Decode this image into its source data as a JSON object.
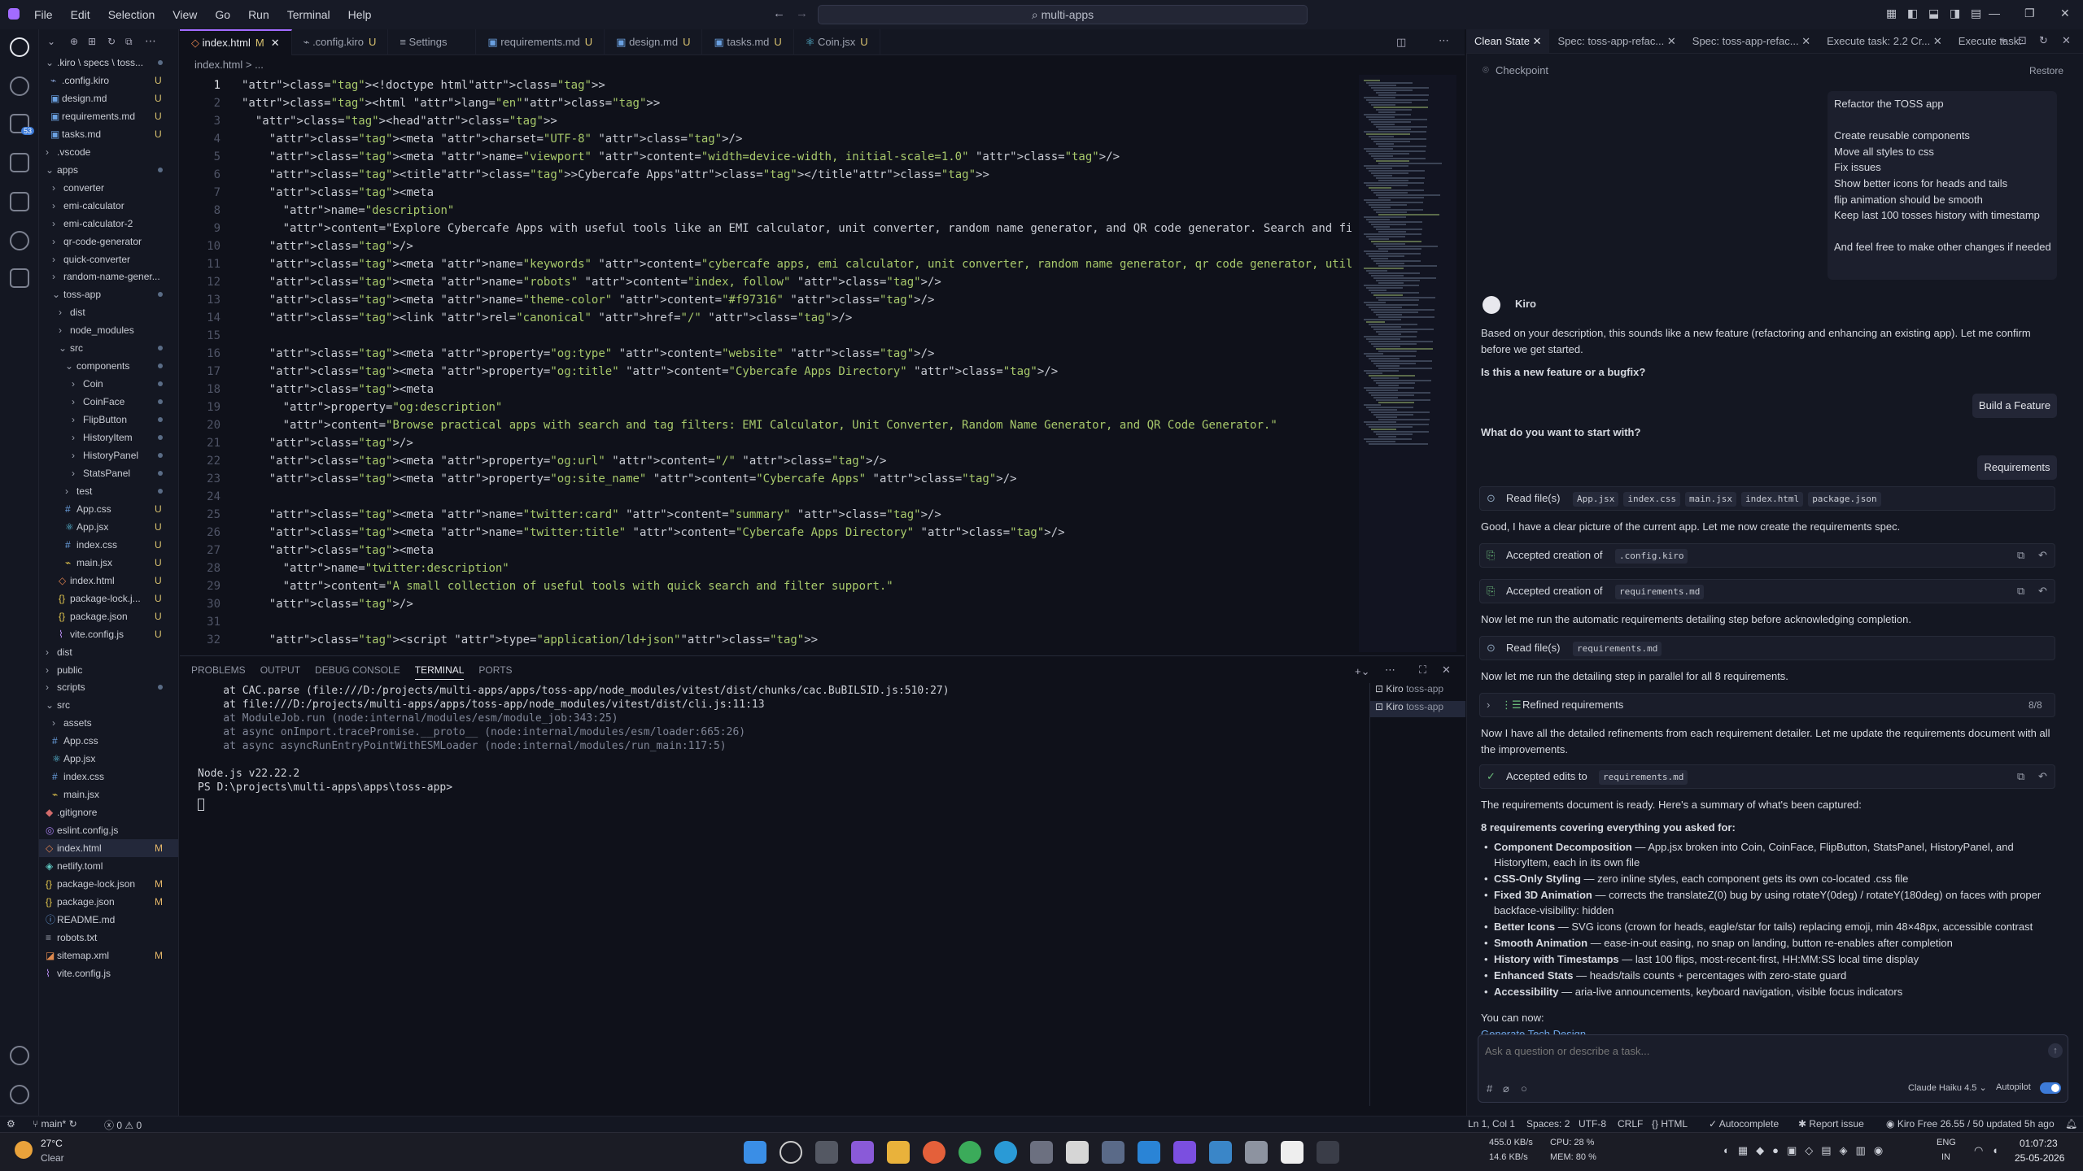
{
  "menubar": {
    "items": [
      "File",
      "Edit",
      "Selection",
      "View",
      "Go",
      "Run",
      "Terminal",
      "Help"
    ],
    "search": "multi-apps"
  },
  "explorer": {
    "rows": [
      {
        "label": ".kiro \\ specs \\ toss...",
        "status": "•"
      },
      {
        "label": ".config.kiro",
        "status": "U"
      },
      {
        "label": "design.md",
        "status": "U"
      },
      {
        "label": "requirements.md",
        "status": "U"
      },
      {
        "label": "tasks.md",
        "status": "U"
      },
      {
        "label": ".vscode",
        "status": ""
      },
      {
        "label": "apps",
        "status": "•"
      },
      {
        "label": "converter",
        "status": ""
      },
      {
        "label": "emi-calculator",
        "status": ""
      },
      {
        "label": "emi-calculator-2",
        "status": ""
      },
      {
        "label": "qr-code-generator",
        "status": ""
      },
      {
        "label": "quick-converter",
        "status": ""
      },
      {
        "label": "random-name-gener...",
        "status": ""
      },
      {
        "label": "toss-app",
        "status": "•"
      },
      {
        "label": "dist",
        "status": ""
      },
      {
        "label": "node_modules",
        "status": ""
      },
      {
        "label": "src",
        "status": "•"
      },
      {
        "label": "components",
        "status": "•"
      },
      {
        "label": "Coin",
        "status": "•"
      },
      {
        "label": "CoinFace",
        "status": "•"
      },
      {
        "label": "FlipButton",
        "status": "•"
      },
      {
        "label": "HistoryItem",
        "status": "•"
      },
      {
        "label": "HistoryPanel",
        "status": "•"
      },
      {
        "label": "StatsPanel",
        "status": "•"
      },
      {
        "label": "test",
        "status": "•"
      },
      {
        "label": "App.css",
        "status": "U"
      },
      {
        "label": "App.jsx",
        "status": "U"
      },
      {
        "label": "index.css",
        "status": "U"
      },
      {
        "label": "main.jsx",
        "status": "U"
      },
      {
        "label": "index.html",
        "status": "U"
      },
      {
        "label": "package-lock.j...",
        "status": "U"
      },
      {
        "label": "package.json",
        "status": "U"
      },
      {
        "label": "vite.config.js",
        "status": "U"
      },
      {
        "label": "dist",
        "status": ""
      },
      {
        "label": "public",
        "status": ""
      },
      {
        "label": "scripts",
        "status": "•"
      },
      {
        "label": "src",
        "status": ""
      },
      {
        "label": "assets",
        "status": ""
      },
      {
        "label": "App.css",
        "status": ""
      },
      {
        "label": "App.jsx",
        "status": ""
      },
      {
        "label": "index.css",
        "status": ""
      },
      {
        "label": "main.jsx",
        "status": ""
      },
      {
        "label": ".gitignore",
        "status": ""
      },
      {
        "label": "eslint.config.js",
        "status": ""
      },
      {
        "label": "index.html",
        "status": "M"
      },
      {
        "label": "netlify.toml",
        "status": ""
      },
      {
        "label": "package-lock.json",
        "status": "M"
      },
      {
        "label": "package.json",
        "status": "M"
      },
      {
        "label": "README.md",
        "status": ""
      },
      {
        "label": "robots.txt",
        "status": ""
      },
      {
        "label": "sitemap.xml",
        "status": "M"
      },
      {
        "label": "vite.config.js",
        "status": ""
      }
    ]
  },
  "tabs": [
    {
      "label": "index.html",
      "status": "M"
    },
    {
      "label": ".config.kiro",
      "status": "U"
    },
    {
      "label": "Settings",
      "status": ""
    },
    {
      "label": "requirements.md",
      "status": "U"
    },
    {
      "label": "design.md",
      "status": "U"
    },
    {
      "label": "tasks.md",
      "status": "U"
    },
    {
      "label": "Coin.jsx",
      "status": "U"
    }
  ],
  "breadcrumb": "index.html > ...",
  "editor": {
    "lines": [
      "<!doctype html>",
      "<html lang=\"en\">",
      "  <head>",
      "    <meta charset=\"UTF-8\" />",
      "    <meta name=\"viewport\" content=\"width=device-width, initial-scale=1.0\" />",
      "    <title>Cybercafe Apps</title>",
      "    <meta",
      "      name=\"description\"",
      "      content=\"Explore Cybercafe Apps with useful tools like an EMI calculator, unit converter, random name generator, and QR code generator. Search and fi",
      "    />",
      "    <meta name=\"keywords\" content=\"cybercafe apps, emi calculator, unit converter, random name generator, qr code generator, utility tools\" />",
      "    <meta name=\"robots\" content=\"index, follow\" />",
      "    <meta name=\"theme-color\" content=\"#f97316\" />",
      "    <link rel=\"canonical\" href=\"/\" />",
      "",
      "    <meta property=\"og:type\" content=\"website\" />",
      "    <meta property=\"og:title\" content=\"Cybercafe Apps Directory\" />",
      "    <meta",
      "      property=\"og:description\"",
      "      content=\"Browse practical apps with search and tag filters: EMI Calculator, Unit Converter, Random Name Generator, and QR Code Generator.\"",
      "    />",
      "    <meta property=\"og:url\" content=\"/\" />",
      "    <meta property=\"og:site_name\" content=\"Cybercafe Apps\" />",
      "",
      "    <meta name=\"twitter:card\" content=\"summary\" />",
      "    <meta name=\"twitter:title\" content=\"Cybercafe Apps Directory\" />",
      "    <meta",
      "      name=\"twitter:description\"",
      "      content=\"A small collection of useful tools with quick search and filter support.\"",
      "    />",
      "",
      "    <script type=\"application/ld+json\">"
    ]
  },
  "panel": {
    "tabs": [
      "PROBLEMS",
      "OUTPUT",
      "DEBUG CONSOLE",
      "TERMINAL",
      "PORTS"
    ],
    "terminal": [
      "    at CAC.parse (file:///D:/projects/multi-apps/apps/toss-app/node_modules/vitest/dist/chunks/cac.BuBILSID.js:510:27)",
      "    at file:///D:/projects/multi-apps/apps/toss-app/node_modules/vitest/dist/cli.js:11:13",
      "    at ModuleJob.run (node:internal/modules/esm/module_job:343:25)",
      "    at async onImport.tracePromise.__proto__ (node:internal/modules/esm/loader:665:26)",
      "    at async asyncRunEntryPointWithESMLoader (node:internal/modules/run_main:117:5)",
      "",
      "Node.js v22.22.2",
      "PS D:\\projects\\multi-apps\\apps\\toss-app>"
    ],
    "terminals": [
      {
        "name": "Kiro",
        "cwd": "toss-app"
      },
      {
        "name": "Kiro",
        "cwd": "toss-app"
      }
    ]
  },
  "chat": {
    "tabs": [
      "Clean State",
      "Spec: toss-app-refac...",
      "Spec: toss-app-refac...",
      "Execute task: 2.2 Cr...",
      "Execute task:"
    ],
    "checkpoint": "Checkpoint",
    "restore": "Restore",
    "user_message": [
      "Refactor the TOSS app",
      "",
      "Create reusable components",
      "Move all styles to css",
      "Fix issues",
      "Show better icons for heads and tails",
      "flip animation should be smooth",
      "Keep last 100 tosses history with timestamp",
      "",
      "And feel free to make other changes if needed"
    ],
    "agent_name": "Kiro",
    "intro": "Based on your description, this sounds like a new feature (refactoring and enhancing an existing app). Let me confirm before we get started.",
    "q1": "Is this a new feature or a bugfix?",
    "a1": "Build a Feature",
    "q2": "What do you want to start with?",
    "a2": "Requirements",
    "read_files": "Read file(s)",
    "read_chips": [
      "App.jsx",
      "index.css",
      "main.jsx",
      "index.html",
      "package.json"
    ],
    "good": "Good, I have a clear picture of the current app. Let me now create the requirements spec.",
    "accepted1": "Accepted creation of",
    "accepted1_chip": ".config.kiro",
    "accepted2": "Accepted creation of",
    "accepted2_chip": "requirements.md",
    "now1": "Now let me run the automatic requirements detailing step before acknowledging completion.",
    "read2": "Read file(s)",
    "read2_chip": "requirements.md",
    "now2": "Now let me run the detailing step in parallel for all 8 requirements.",
    "refined": "Refined requirements",
    "refined_count": "8/8",
    "all": "Now I have all the detailed refinements from each requirement detailer. Let me update the requirements document with all the improvements.",
    "accepted_edits": "Accepted edits to",
    "accepted_edits_chip": "requirements.md",
    "summary": "The requirements document is ready. Here's a summary of what's been captured:",
    "summary_head": "8 requirements covering everything you asked for:",
    "bullets": [
      {
        "b": "Component Decomposition",
        "t": " — App.jsx broken into Coin, CoinFace, FlipButton, StatsPanel, HistoryPanel, and HistoryItem, each in its own file"
      },
      {
        "b": "CSS-Only Styling",
        "t": " — zero inline styles, each component gets its own co-located .css file"
      },
      {
        "b": "Fixed 3D Animation",
        "t": " — corrects the translateZ(0) bug by using rotateY(0deg) / rotateY(180deg) on faces with proper backface-visibility: hidden"
      },
      {
        "b": "Better Icons",
        "t": " — SVG icons (crown for heads, eagle/star for tails) replacing emoji, min 48×48px, accessible contrast"
      },
      {
        "b": "Smooth Animation",
        "t": " — ease-in-out easing, no snap on landing, button re-enables after completion"
      },
      {
        "b": "History with Timestamps",
        "t": " — last 100 flips, most-recent-first, HH:MM:SS local time display"
      },
      {
        "b": "Enhanced Stats",
        "t": " — heads/tails counts + percentages with zero-state guard"
      },
      {
        "b": "Accessibility",
        "t": " — aria-live announcements, keyboard navigation, visible focus indicators"
      }
    ],
    "you_can": "You can now:",
    "next_link": "Generate Tech Design",
    "input_placeholder": "Ask a question or describe a task...",
    "model": "Claude Haiku 4.5",
    "autopilot": "Autopilot"
  },
  "statusbar": {
    "branch": "main*",
    "errors": "0",
    "warnings": "0",
    "position": "Ln 1, Col 1",
    "spaces": "Spaces: 2",
    "encoding": "UTF-8",
    "eol": "CRLF",
    "language": "HTML",
    "autocomplete": "Autocomplete",
    "report": "Report issue",
    "plan": "Kiro Free 26.55 / 50 updated 5h ago"
  },
  "taskbar": {
    "temp": "27°C",
    "weather": "Clear",
    "net_up": "455.0 KB/s",
    "net_down": "14.6 KB/s",
    "cpu": "CPU: 28 %",
    "mem": "MEM: 80 %",
    "lang1": "ENG",
    "lang2": "IN",
    "time": "01:07:23",
    "date": "25-05-2026"
  },
  "colors": {
    "accent": "#a26bff",
    "bg": "#0f111a"
  }
}
